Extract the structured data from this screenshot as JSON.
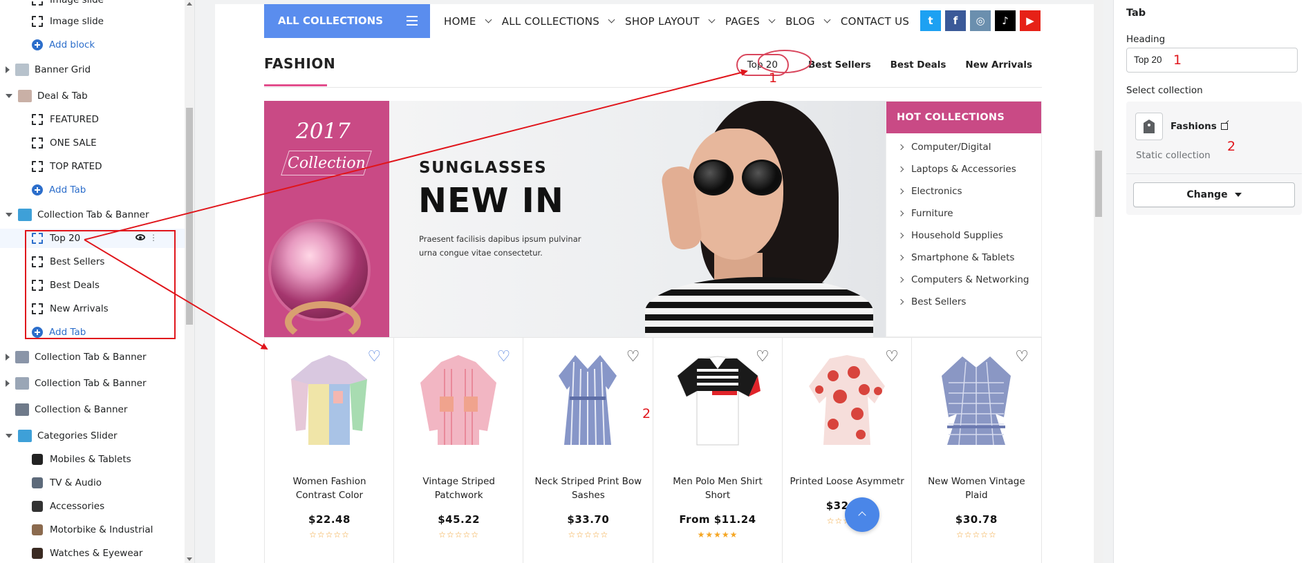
{
  "left_sidebar": {
    "rows": [
      {
        "label": "Image slide",
        "kind": "block"
      },
      {
        "label": "Image slide",
        "kind": "block"
      },
      {
        "label": "Add block",
        "kind": "add"
      },
      {
        "label": "Banner Grid",
        "kind": "section",
        "caret": "right"
      },
      {
        "label": "Deal & Tab",
        "kind": "section",
        "caret": "down"
      },
      {
        "label": "FEATURED",
        "kind": "block"
      },
      {
        "label": "ONE SALE",
        "kind": "block"
      },
      {
        "label": "TOP RATED",
        "kind": "block"
      },
      {
        "label": "Add Tab",
        "kind": "add"
      },
      {
        "label": "Collection Tab & Banner",
        "kind": "section",
        "caret": "down"
      },
      {
        "label": "Top 20",
        "kind": "block"
      },
      {
        "label": "Best Sellers",
        "kind": "block"
      },
      {
        "label": "Best Deals",
        "kind": "block"
      },
      {
        "label": "New Arrivals",
        "kind": "block"
      },
      {
        "label": "Add Tab",
        "kind": "add"
      },
      {
        "label": "Collection Tab & Banner",
        "kind": "section",
        "caret": "right"
      },
      {
        "label": "Collection Tab & Banner",
        "kind": "section",
        "caret": "right"
      },
      {
        "label": "Collection & Banner",
        "kind": "section",
        "caret": "none"
      },
      {
        "label": "Categories Slider",
        "kind": "section",
        "caret": "down"
      },
      {
        "label": "Mobiles & Tablets",
        "kind": "sub"
      },
      {
        "label": "TV & Audio",
        "kind": "sub"
      },
      {
        "label": "Accessories",
        "kind": "sub"
      },
      {
        "label": "Motorbike & Industrial",
        "kind": "sub"
      },
      {
        "label": "Watches & Eyewear",
        "kind": "sub"
      }
    ]
  },
  "store": {
    "nav": {
      "all_collections_button": "ALL COLLECTIONS",
      "menu": [
        {
          "label": "HOME",
          "has_dropdown": true
        },
        {
          "label": "ALL COLLECTIONS",
          "has_dropdown": true
        },
        {
          "label": "SHOP LAYOUT",
          "has_dropdown": true
        },
        {
          "label": "PAGES",
          "has_dropdown": true
        },
        {
          "label": "BLOG",
          "has_dropdown": true
        },
        {
          "label": "CONTACT US",
          "has_dropdown": false
        }
      ],
      "socials": [
        {
          "name": "twitter-icon",
          "glyph": "t",
          "color": "#1da1f2"
        },
        {
          "name": "facebook-icon",
          "glyph": "f",
          "color": "#3b5998"
        },
        {
          "name": "instagram-icon",
          "glyph": "◎",
          "color": "#6b8fae"
        },
        {
          "name": "tiktok-icon",
          "glyph": "♪",
          "color": "#000000"
        },
        {
          "name": "youtube-icon",
          "glyph": "▶",
          "color": "#e62117"
        }
      ]
    },
    "section_title": "FASHION",
    "tabs": [
      "Top 20",
      "Best Sellers",
      "Best Deals",
      "New Arrivals"
    ],
    "banner": {
      "year": "2017",
      "collection_word": "Collection",
      "subtitle": "SUNGLASSES",
      "headline": "NEW IN",
      "description": "Praesent facilisis dapibus ipsum pulvinar urna congue vitae consectetur."
    },
    "hot_collections": {
      "title": "HOT COLLECTIONS",
      "items": [
        "Computer/Digital",
        "Laptops & Accessories",
        "Electronics",
        "Furniture",
        "Household Supplies",
        "Smartphone & Tablets",
        "Computers & Networking",
        "Best Sellers"
      ]
    },
    "products": [
      {
        "name": "Women Fashion Contrast Color",
        "price": "$22.48",
        "stars": "☆☆☆☆☆",
        "heart": "blue"
      },
      {
        "name": "Vintage Striped Patchwork",
        "price": "$45.22",
        "stars": "☆☆☆☆☆",
        "heart": "blue"
      },
      {
        "name": "Neck Striped Print Bow Sashes",
        "price": "$33.70",
        "stars": "☆☆☆☆☆",
        "heart": "dark"
      },
      {
        "name": "Men Polo Men Shirt Short",
        "price": "From $11.24",
        "stars": "★★★★★",
        "heart": "dark"
      },
      {
        "name": "Printed Loose Asymmetr",
        "price": "$32.34",
        "stars": "☆☆☆☆☆",
        "heart": "dark"
      },
      {
        "name": "New Women Vintage Plaid",
        "price": "$30.78",
        "stars": "☆☆☆☆☆",
        "heart": "dark"
      }
    ]
  },
  "settings": {
    "title": "Tab",
    "heading_label": "Heading",
    "heading_value": "Top 20",
    "collection_label": "Select collection",
    "collection_name": "Fashions",
    "collection_type": "Static collection",
    "change_button": "Change"
  },
  "annotations": {
    "num_1": "1",
    "num_2": "2",
    "color": "#e0151b"
  }
}
